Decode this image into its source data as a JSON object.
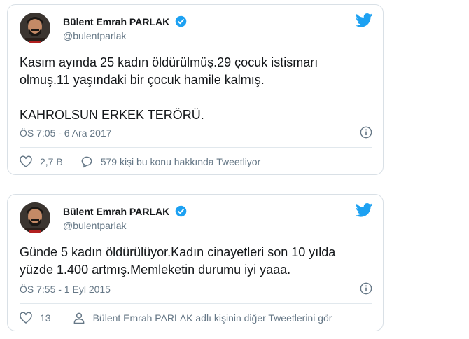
{
  "tweets": [
    {
      "author_name": "Bülent Emrah PARLAK",
      "handle": "@bulentparlak",
      "lines": [
        "Kasım ayında 25 kadın öldürülmüş.29 çocuk istismarı",
        "olmuş.11 yaşındaki bir çocuk hamile kalmış.",
        "",
        "KAHROLSUN ERKEK TERÖRÜ."
      ],
      "timestamp": "ÖS 7:05 - 6 Ara 2017",
      "likes": "2,7 B",
      "secondary_action": "579 kişi bu konu hakkında Tweetliyor",
      "secondary_icon": "speech-bubble-icon"
    },
    {
      "author_name": "Bülent Emrah PARLAK",
      "handle": "@bulentparlak",
      "lines": [
        "Günde 5 kadın öldürülüyor.Kadın cinayetleri son 10 yılda",
        "yüzde 1.400 artmış.Memleketin durumu iyi yaaa."
      ],
      "timestamp": "ÖS 7:55 - 1 Eyl 2015",
      "likes": "13",
      "secondary_action": "Bülent Emrah PARLAK adlı kişinin diğer Tweetlerini gör",
      "secondary_icon": "person-icon"
    }
  ],
  "colors": {
    "twitter_blue": "#1da1f2",
    "text": "#14171a",
    "muted": "#657786",
    "border": "#d9e0e6"
  }
}
